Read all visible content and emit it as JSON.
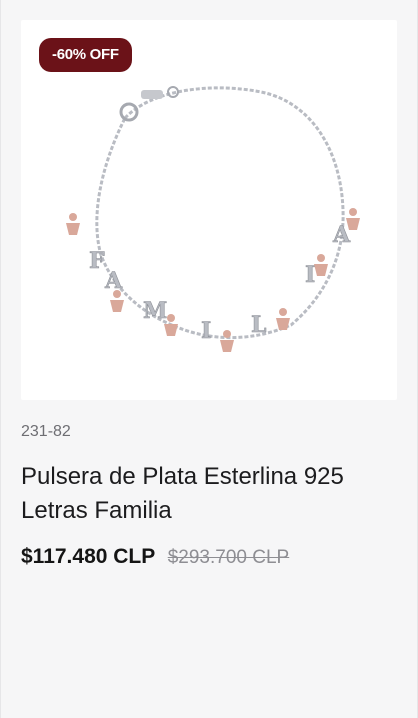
{
  "badge": {
    "label": "-60% OFF"
  },
  "product": {
    "image": {
      "letters": [
        "F",
        "A",
        "M",
        "I",
        "L",
        "I",
        "A"
      ]
    },
    "sku": "231-82",
    "title": "Pulsera de Plata Esterlina 925 Letras Familia",
    "price": "$117.480 CLP",
    "old_price": "$293.700 CLP"
  },
  "colors": {
    "badge_bg": "#6b1218",
    "silver": "#b9bcc3",
    "rose_gold": "#d9a89a"
  }
}
